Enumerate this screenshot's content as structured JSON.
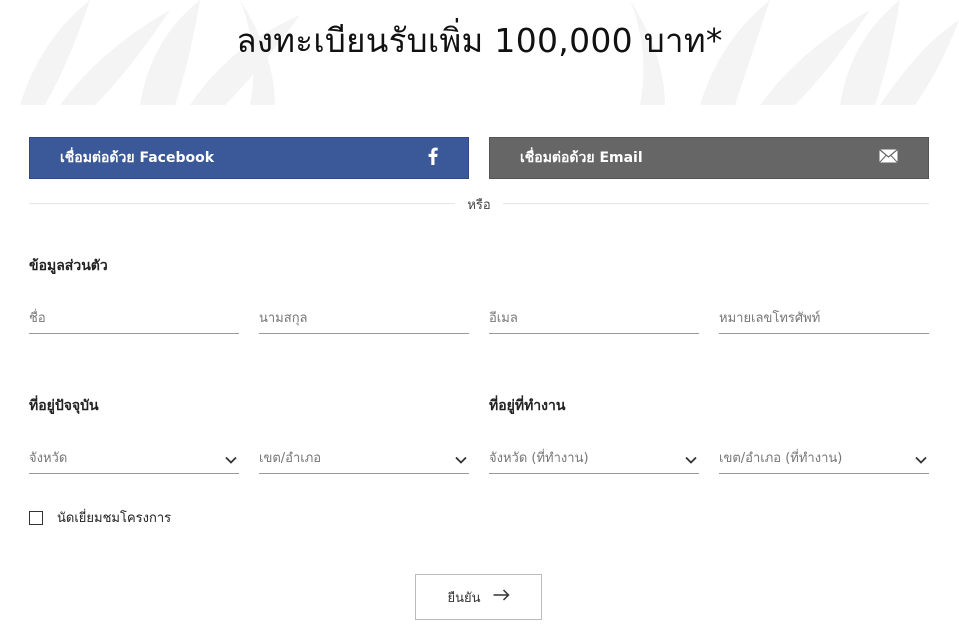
{
  "header": {
    "title": "ลงทะเบียนรับเพิ่ม 100,000 บาท*"
  },
  "social": {
    "facebook_label": "เชื่อมต่อด้วย Facebook",
    "email_label": "เชื่อมต่อด้วย Email",
    "facebook_color": "#3b5998",
    "email_color": "#666666"
  },
  "divider": {
    "or_text": "หรือ"
  },
  "personal": {
    "heading": "ข้อมูลส่วนตัว",
    "first_name_placeholder": "ชื่อ",
    "last_name_placeholder": "นามสกุล",
    "email_placeholder": "อีเมล",
    "phone_placeholder": "หมายเลขโทรศัพท์"
  },
  "current_address": {
    "heading": "ที่อยู่ปัจจุบัน",
    "province": "จังหวัด",
    "district": "เขต/อำเภอ"
  },
  "work_address": {
    "heading": "ที่อยู่ที่ทำงาน",
    "province": "จังหวัด (ที่ทำงาน)",
    "district": "เขต/อำเภอ (ที่ทำงาน)"
  },
  "visit": {
    "label": "นัดเยี่ยมชมโครงการ"
  },
  "submit": {
    "label": "ยืนยัน"
  },
  "icons": {
    "facebook": "facebook-icon",
    "email": "envelope-icon",
    "dropdown": "chevron-down-icon",
    "submit": "arrow-right-icon"
  }
}
